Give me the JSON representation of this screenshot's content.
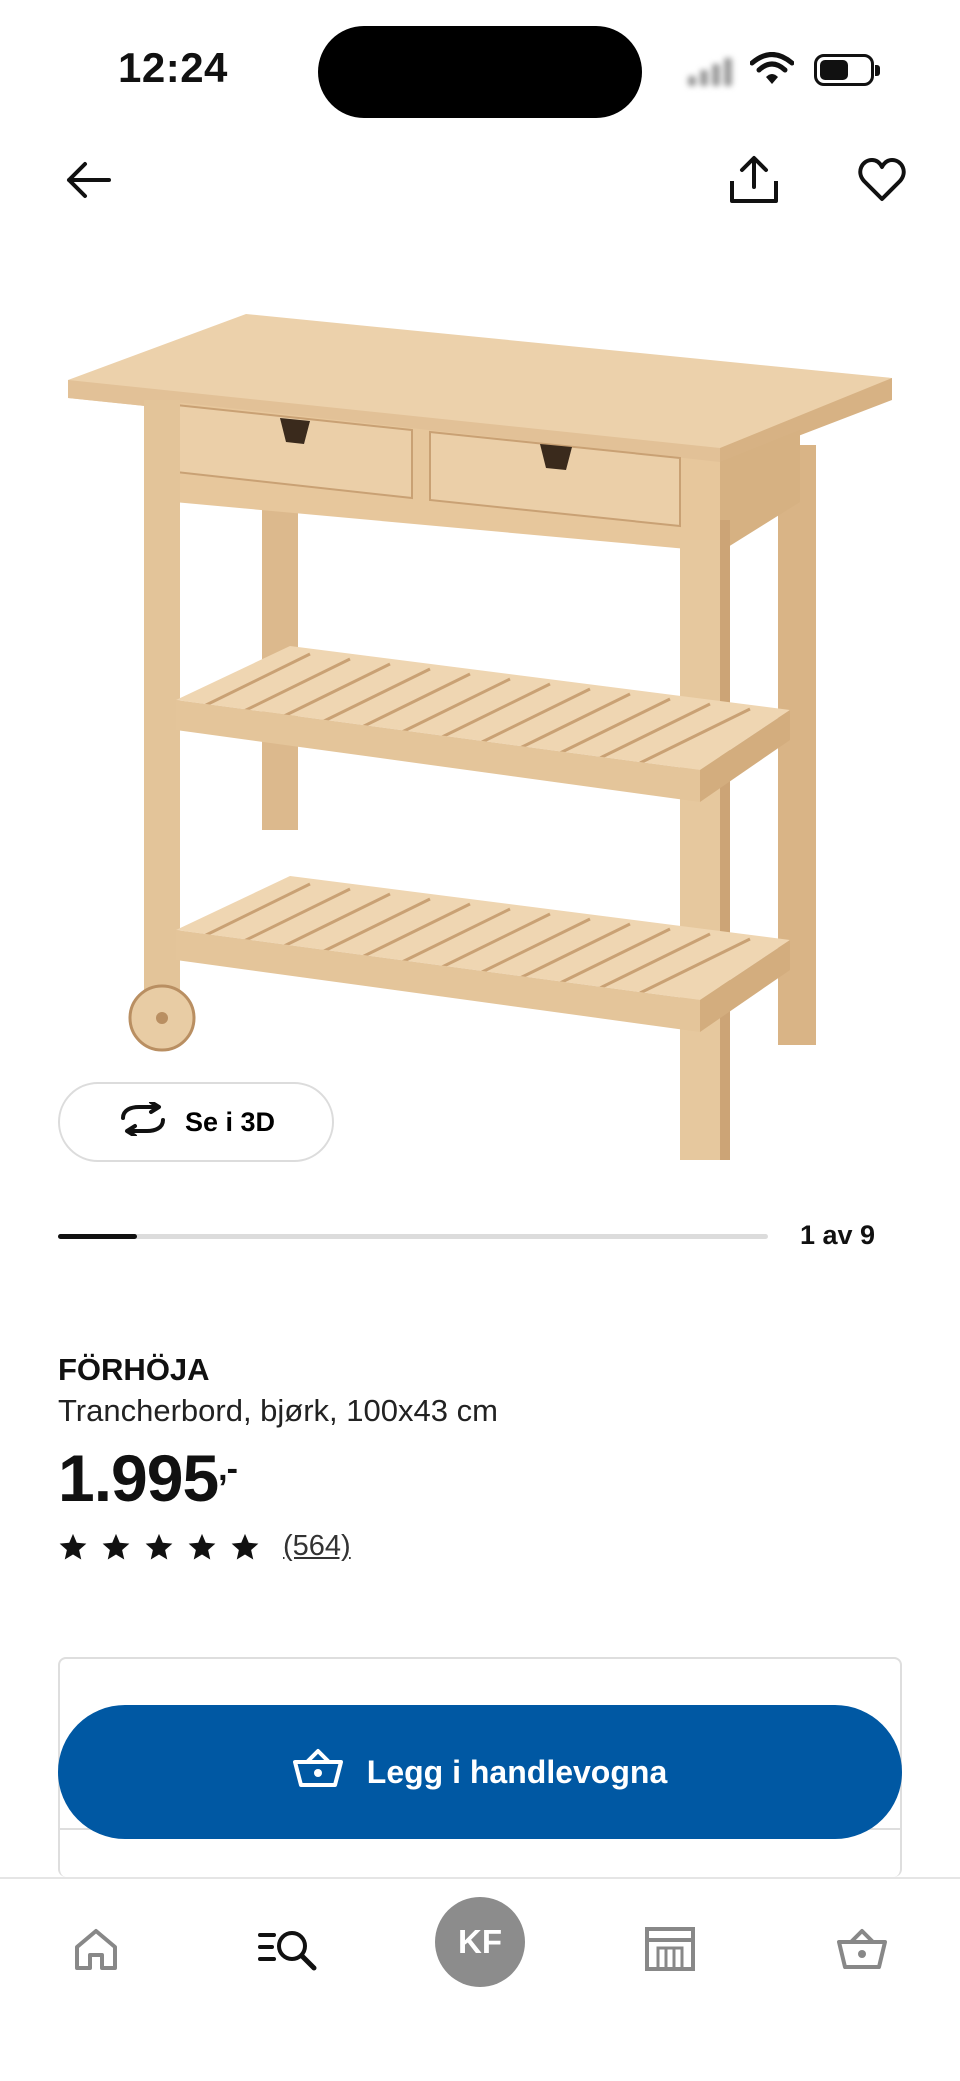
{
  "status_bar": {
    "time": "12:24"
  },
  "gallery": {
    "see_3d_label": "Se i 3D",
    "counter": "1 av 9",
    "progress_fraction": 0.111
  },
  "product": {
    "name": "FÖRHÖJA",
    "description": "Trancherbord, bjørk, 100x43 cm",
    "price": "1.995",
    "price_suffix": ",-",
    "rating_stars": 5,
    "review_count": "(564)"
  },
  "actions": {
    "add_to_cart": "Legg i handlevogna"
  },
  "tab_bar": {
    "tabs": [
      "home-icon",
      "search-icon",
      "account-avatar",
      "store-icon",
      "cart-icon"
    ],
    "avatar_initials": "KF"
  },
  "colors": {
    "primary_blue": "#0058a3",
    "wood": "#e8c9a0",
    "avatar_gray": "#8c8c8c"
  }
}
